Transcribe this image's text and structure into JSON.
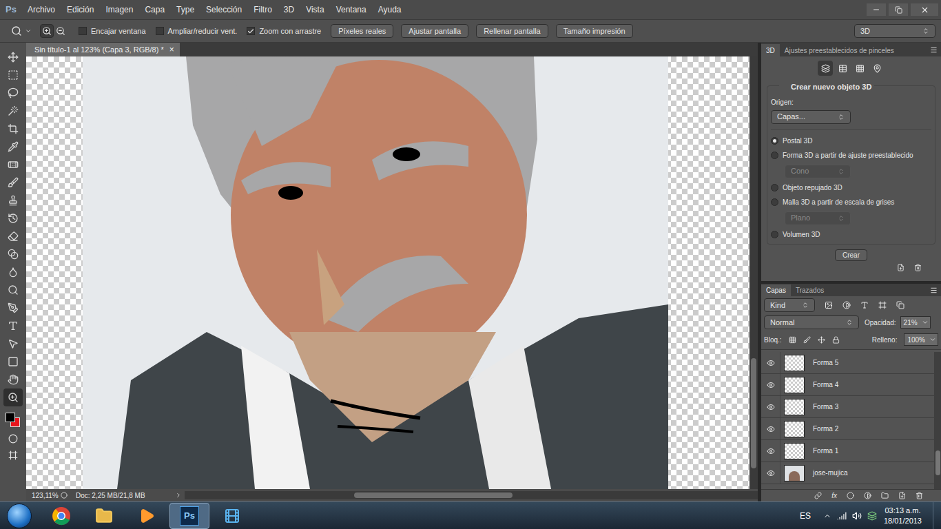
{
  "app": {
    "logo": "Ps"
  },
  "menu": [
    "Archivo",
    "Edición",
    "Imagen",
    "Capa",
    "Type",
    "Selección",
    "Filtro",
    "3D",
    "Vista",
    "Ventana",
    "Ayuda"
  ],
  "options_bar": {
    "checkboxes": [
      {
        "label": "Encajar ventana",
        "checked": false
      },
      {
        "label": "Ampliar/reducir vent.",
        "checked": false
      },
      {
        "label": "Zoom con arrastre",
        "checked": true
      }
    ],
    "buttons": [
      "Píxeles reales",
      "Ajustar pantalla",
      "Rellenar pantalla",
      "Tamaño impresión"
    ],
    "workspace": "3D"
  },
  "tools": [
    {
      "selected": false
    },
    {
      "selected": false
    },
    {
      "selected": false
    },
    {
      "selected": false
    },
    {
      "selected": false
    },
    {
      "selected": false
    },
    {
      "selected": false
    },
    {
      "selected": false
    },
    {
      "selected": false
    },
    {
      "selected": false
    },
    {
      "selected": false
    },
    {
      "selected": false
    },
    {
      "selected": false
    },
    {
      "selected": false
    },
    {
      "selected": false
    },
    {
      "selected": false
    },
    {
      "selected": false
    },
    {
      "selected": false
    },
    {
      "selected": false
    },
    {
      "selected": true
    }
  ],
  "colors": {
    "foreground": "#000000",
    "background": "#e8141c"
  },
  "document": {
    "tab": "Sin título-1 al 123% (Capa 3, RGB/8) *",
    "close": "×"
  },
  "status_bar": {
    "zoom": "123,11%",
    "doc": "Doc: 2,25 MB/21,8 MB"
  },
  "panel_3d": {
    "tabs": [
      {
        "label": "3D",
        "selected": true
      },
      {
        "label": "Ajustes preestablecidos de pinceles",
        "selected": false
      }
    ],
    "view_icons": [
      {
        "selected": true
      },
      {
        "selected": false
      },
      {
        "selected": false
      },
      {
        "selected": false
      }
    ],
    "heading": "Crear nuevo objeto 3D",
    "origin_label": "Origen:",
    "origin": "Capas...",
    "options": [
      {
        "kind": "radio",
        "label": "Postal 3D",
        "selected": true
      },
      {
        "kind": "radio",
        "label": "Forma 3D a partir de ajuste preestablecido",
        "selected": false
      },
      {
        "kind": "select",
        "label": "Cono",
        "disabled": true
      },
      {
        "kind": "radio",
        "label": "Objeto repujado 3D",
        "selected": false
      },
      {
        "kind": "radio",
        "label": "Malla 3D a partir de escala de grises",
        "selected": false
      },
      {
        "kind": "select",
        "label": "Plano",
        "disabled": true
      },
      {
        "kind": "radio",
        "label": "Volumen 3D",
        "selected": false
      }
    ],
    "button": "Crear"
  },
  "layers_panel": {
    "tabs": [
      {
        "label": "Capas",
        "selected": true
      },
      {
        "label": "Trazados",
        "selected": false
      }
    ],
    "filter": "Kind",
    "blend_mode": "Normal",
    "opacity_label": "Opacidad:",
    "opacity": "21%",
    "lock_label": "Bloq.:",
    "fill_label": "Relleno:",
    "fill": "100%",
    "fx_label": "fx",
    "layers": [
      {
        "name": "Forma 5",
        "kind": "shape",
        "visible": true,
        "selected": false
      },
      {
        "name": "Forma 4",
        "kind": "shape",
        "visible": true,
        "selected": false
      },
      {
        "name": "Forma 3",
        "kind": "shape",
        "visible": true,
        "selected": false
      },
      {
        "name": "Forma 2",
        "kind": "shape",
        "visible": true,
        "selected": false
      },
      {
        "name": "Forma 1",
        "kind": "shape",
        "visible": true,
        "selected": false
      },
      {
        "name": "jose-mujica",
        "kind": "photo",
        "visible": true,
        "selected": false
      }
    ]
  },
  "taskbar": {
    "apps": [
      {
        "label": "",
        "selected": false
      },
      {
        "label": "",
        "selected": false
      },
      {
        "label": "",
        "selected": false
      },
      {
        "label": "Ps",
        "selected": true
      },
      {
        "label": "",
        "selected": false
      }
    ],
    "language": "ES",
    "time": "03:13 a.m.",
    "date": "18/01/2013"
  }
}
